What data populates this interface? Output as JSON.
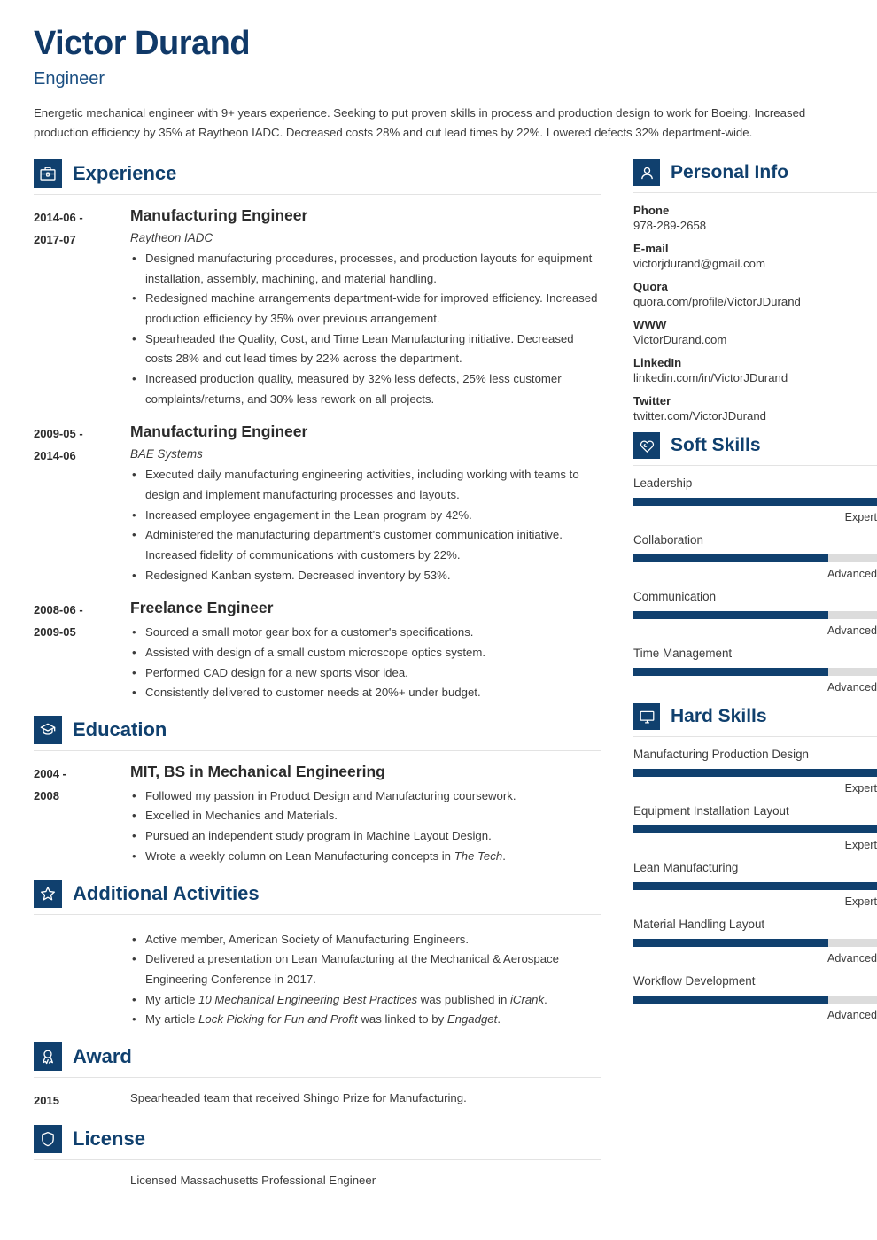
{
  "header": {
    "name": "Victor Durand",
    "job_title": "Engineer",
    "summary": "Energetic mechanical engineer with 9+ years experience. Seeking to put proven skills in process and production design to work for Boeing. Increased production efficiency by 35% at Raytheon IADC. Decreased costs 28% and cut lead times by 22%. Lowered defects 32% department-wide."
  },
  "colors": {
    "accent": "#10406e",
    "name_color": "#103968",
    "title_color": "#1b4f82",
    "bar_track": "#dcdcdc",
    "rule": "#e3e3e3",
    "text": "#3b3b3b"
  },
  "sections": {
    "experience": {
      "title": "Experience",
      "icon": "briefcase-icon",
      "entries": [
        {
          "date": "2014-06 - 2017-07",
          "date_line1": "2014-06 -",
          "date_line2": "2017-07",
          "title": "Manufacturing Engineer",
          "org": "Raytheon IADC",
          "bullets": [
            "Designed manufacturing procedures, processes, and production layouts for equipment installation, assembly, machining, and material handling.",
            "Redesigned machine arrangements department-wide for improved efficiency. Increased production efficiency by 35% over previous arrangement.",
            "Spearheaded the Quality, Cost, and Time Lean Manufacturing initiative. Decreased costs 28% and cut lead times by 22% across the department.",
            "Increased production quality, measured by 32% less defects, 25% less customer complaints/returns, and 30% less rework on all projects."
          ]
        },
        {
          "date": "2009-05 - 2014-06",
          "date_line1": "2009-05 -",
          "date_line2": "2014-06",
          "title": "Manufacturing Engineer",
          "org": "BAE Systems",
          "bullets": [
            "Executed daily manufacturing engineering activities, including working with teams to design and implement manufacturing processes and layouts.",
            "Increased employee engagement in the Lean program by 42%.",
            "Administered the manufacturing department's customer communication initiative. Increased fidelity of communications with customers by 22%.",
            "Redesigned Kanban system. Decreased inventory by 53%."
          ]
        },
        {
          "date": "2008-06 - 2009-05",
          "date_line1": "2008-06 -",
          "date_line2": "2009-05",
          "title": "Freelance Engineer",
          "org": "",
          "bullets": [
            "Sourced a small motor gear box for a customer's specifications.",
            "Assisted with design of a small custom microscope optics system.",
            "Performed CAD design for a new sports visor idea.",
            "Consistently delivered to customer needs at 20%+ under budget."
          ]
        }
      ]
    },
    "education": {
      "title": "Education",
      "icon": "graduation-cap-icon",
      "entries": [
        {
          "date_line1": "2004 -",
          "date_line2": "2008",
          "title": "MIT, BS in Mechanical Engineering",
          "bullets": [
            "Followed my passion in Product Design and Manufacturing coursework.",
            "Excelled in Mechanics and Materials.",
            "Pursued an independent study program in Machine Layout Design.",
            "Wrote a weekly column on Lean Manufacturing concepts in <i>The Tech</i>."
          ]
        }
      ]
    },
    "additional_activities": {
      "title": "Additional Activities",
      "icon": "star-icon",
      "bullets": [
        "Active member, American Society of Manufacturing Engineers.",
        "Delivered a presentation on Lean Manufacturing at the Mechanical &amp; Aerospace Engineering Conference in 2017.",
        "My article <i>10 Mechanical Engineering Best Practices</i> was published in <i>iCrank</i>.",
        "My article <i>Lock Picking for Fun and Profit</i> was linked to by <i>Engadget</i>."
      ]
    },
    "award": {
      "title": "Award",
      "icon": "medal-ribbon-icon",
      "date": "2015",
      "text": "Spearheaded team that received Shingo Prize for Manufacturing."
    },
    "license": {
      "title": "License",
      "icon": "shield-icon",
      "text": "Licensed Massachusetts Professional Engineer"
    },
    "personal_info": {
      "title": "Personal Info",
      "icon": "person-icon",
      "items": [
        {
          "label": "Phone",
          "value": "978-289-2658"
        },
        {
          "label": "E-mail",
          "value": "victorjdurand@gmail.com"
        },
        {
          "label": "Quora",
          "value": "quora.com/profile/VictorJDurand"
        },
        {
          "label": "WWW",
          "value": "VictorDurand.com"
        },
        {
          "label": "LinkedIn",
          "value": "linkedin.com/in/VictorJDurand"
        },
        {
          "label": "Twitter",
          "value": "twitter.com/VictorJDurand"
        }
      ]
    },
    "soft_skills": {
      "title": "Soft Skills",
      "icon": "heart-icon",
      "items": [
        {
          "name": "Leadership",
          "level": "Expert",
          "percent": 100
        },
        {
          "name": "Collaboration",
          "level": "Advanced",
          "percent": 80
        },
        {
          "name": "Communication",
          "level": "Advanced",
          "percent": 80
        },
        {
          "name": "Time Management",
          "level": "Advanced",
          "percent": 80
        }
      ]
    },
    "hard_skills": {
      "title": "Hard Skills",
      "icon": "monitor-icon",
      "items": [
        {
          "name": "Manufacturing Production Design",
          "level": "Expert",
          "percent": 100
        },
        {
          "name": "Equipment Installation Layout",
          "level": "Expert",
          "percent": 100
        },
        {
          "name": "Lean Manufacturing",
          "level": "Expert",
          "percent": 100
        },
        {
          "name": "Material Handling Layout",
          "level": "Advanced",
          "percent": 80
        },
        {
          "name": "Workflow Development",
          "level": "Advanced",
          "percent": 80
        }
      ]
    }
  }
}
